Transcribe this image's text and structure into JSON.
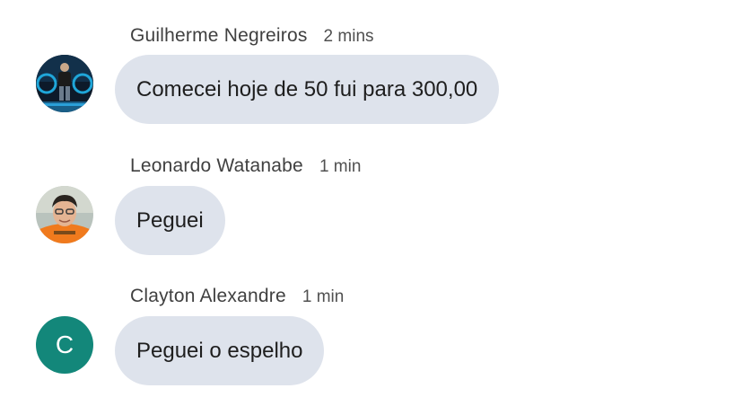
{
  "comments": [
    {
      "author": "Guilherme Negreiros",
      "time": "2 mins",
      "text": "Comecei hoje de 50 fui para 300,00",
      "avatar": "photo-avatar-performer"
    },
    {
      "author": "Leonardo Watanabe",
      "time": "1 min",
      "text": "Peguei",
      "avatar": "photo-avatar-man"
    },
    {
      "author": "Clayton Alexandre",
      "time": "1 min",
      "text": "Peguei o espelho",
      "avatar_letter": "C",
      "avatar_color": "#13877a"
    }
  ]
}
